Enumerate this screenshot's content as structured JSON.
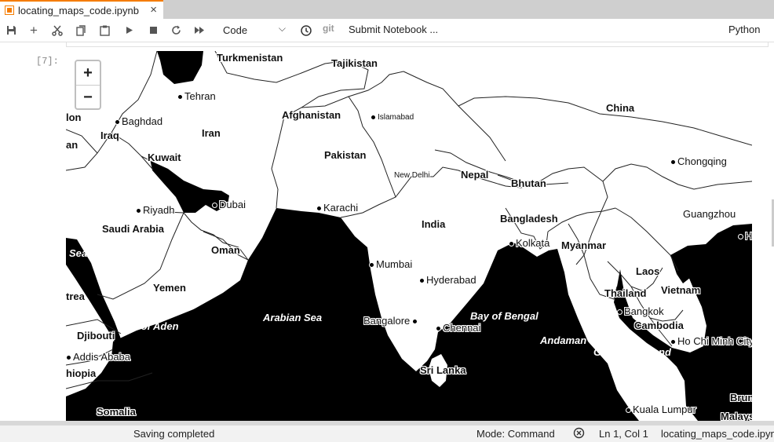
{
  "tab": {
    "title": "locating_maps_code.ipynb",
    "close": "×"
  },
  "toolbar": {
    "cell_type": "Code",
    "git_label": "git",
    "submit_label": "Submit Notebook ...",
    "kernel_name": "Python"
  },
  "cell": {
    "prompt": "[7]:"
  },
  "map": {
    "zoom_in": "+",
    "zoom_out": "−",
    "labels": {
      "turkmenistan": "Turkmenistan",
      "tajikistan": "Tajikistan",
      "tehran": "Tehran",
      "china": "China",
      "baghdad": "Baghdad",
      "iraq": "Iraq",
      "iran": "Iran",
      "afghanistan": "Afghanistan",
      "islamabad": "Islamabad",
      "kuwait": "Kuwait",
      "pakistan": "Pakistan",
      "nepal": "Nepal",
      "new_delhi": "New Delhi",
      "bhutan": "Bhutan",
      "chongqing": "Chongqing",
      "riyadh": "Riyadh",
      "dubai": "Dubai",
      "karachi": "Karachi",
      "guangzhou": "Guangzhou",
      "saudi_arabia": "Saudi Arabia",
      "india": "India",
      "bangladesh": "Bangladesh",
      "kolkata": "Kolkata",
      "myanmar": "Myanmar",
      "oman": "Oman",
      "mumbai": "Mumbai",
      "laos": "Laos",
      "hyderabad": "Hyderabad",
      "yemen": "Yemen",
      "thailand": "Thailand",
      "vietnam": "Vietnam",
      "bangkok": "Bangkok",
      "arabian_sea": "Arabian Sea",
      "bay_of_bengal": "Bay of Bengal",
      "gulf_of_aden": "Gulf of Aden",
      "bangalore": "Bangalore",
      "chennai": "Chennai",
      "cambodia": "Cambodia",
      "djibouti": "Djibouti",
      "andaman_sea": "Andaman Sea",
      "ho_chi_minh": "Ho Chi Minh City",
      "gulf_of_thailand": "Gulf of Thailand",
      "addis_ababa": "Addis Ababa",
      "sri_lanka": "Sri Lanka",
      "ethiopia_partial": "hiopia",
      "eritrea_partial": "trea",
      "red_sea_partial": "Sea",
      "jordan_partial": "lon",
      "syria_partial": "an",
      "somalia": "Somalia",
      "kuala_lumpur": "Kuala Lumpur",
      "brunei_partial": "Brun",
      "malaysia_partial": "Malays",
      "hongkong_partial": "H"
    }
  },
  "status": {
    "saving": "Saving completed",
    "mode": "Mode: Command",
    "cursor": "Ln 1, Col 1",
    "filename": "locating_maps_code.ipynb"
  }
}
